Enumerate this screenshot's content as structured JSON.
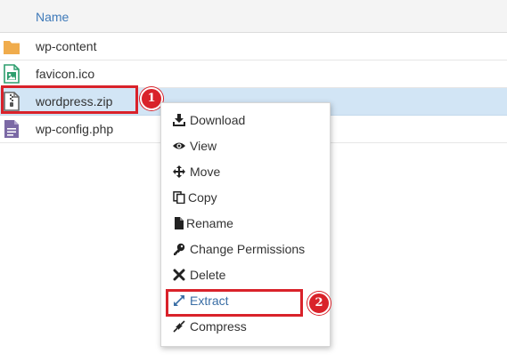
{
  "file_table": {
    "column_header": "Name",
    "files": [
      {
        "name": "wp-content",
        "icon": "folder-icon"
      },
      {
        "name": "favicon.ico",
        "icon": "image-file-icon"
      },
      {
        "name": "wordpress.zip",
        "icon": "zip-file-icon",
        "selected": true
      },
      {
        "name": "wp-config.php",
        "icon": "php-file-icon"
      }
    ]
  },
  "context_menu": {
    "items": [
      {
        "label": "Download",
        "icon": "download-icon"
      },
      {
        "label": "View",
        "icon": "eye-icon"
      },
      {
        "label": "Move",
        "icon": "move-arrows-icon"
      },
      {
        "label": "Copy",
        "icon": "copy-icon"
      },
      {
        "label": "Rename",
        "icon": "file-icon"
      },
      {
        "label": "Change Permissions",
        "icon": "key-icon"
      },
      {
        "label": "Delete",
        "icon": "x-icon"
      },
      {
        "label": "Extract",
        "icon": "expand-icon"
      },
      {
        "label": "Compress",
        "icon": "compress-icon"
      }
    ]
  },
  "annotations": {
    "step1": "1",
    "step2": "2",
    "highlight_color": "#d9222a"
  },
  "colors": {
    "header_text": "#3f7ab9",
    "selected_row": "#d2e5f5",
    "folder": "#f0ac4c",
    "image_file": "#2e9e6e",
    "php_file": "#7b69a5"
  }
}
